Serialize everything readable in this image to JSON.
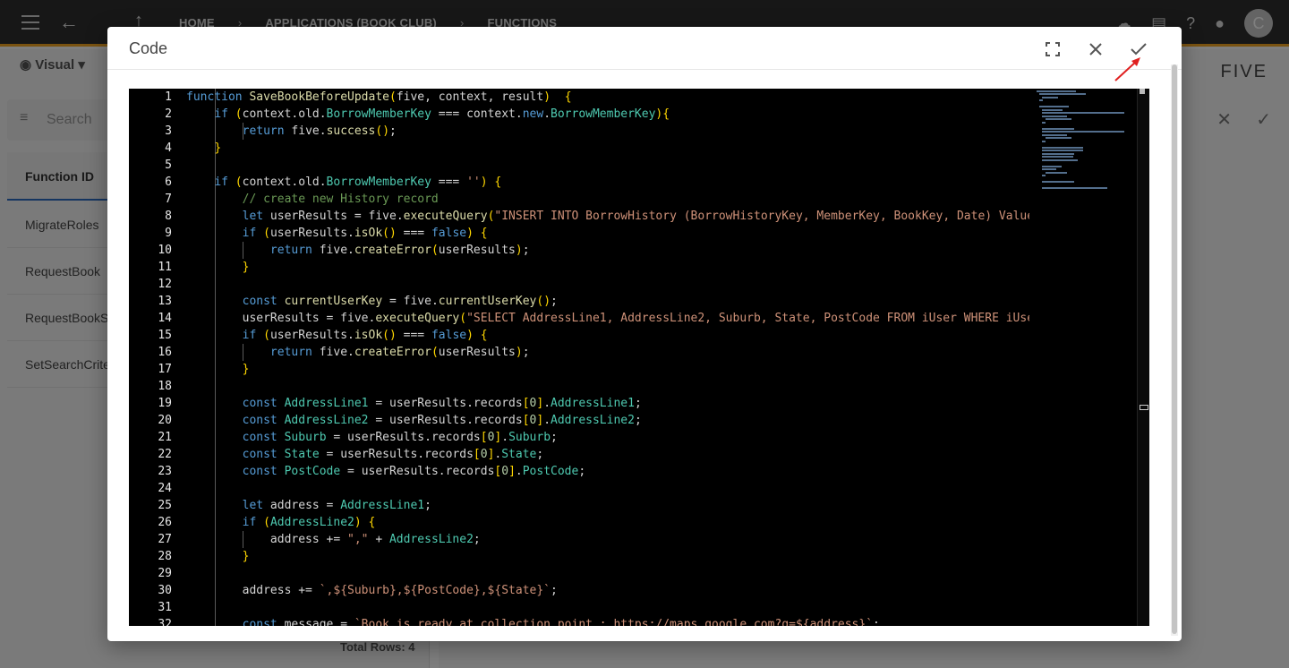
{
  "topbar": {
    "breadcrumbs": [
      "HOME",
      "APPLICATIONS (BOOK CLUB)",
      "FUNCTIONS"
    ],
    "avatar_letter": "C"
  },
  "left_panel": {
    "view_label": "Visual",
    "search_placeholder": "Search",
    "column_header": "Function ID",
    "rows": [
      "MigrateRoles",
      "RequestBook",
      "RequestBookS",
      "SetSearchCrite"
    ],
    "total_rows": "Total Rows: 4"
  },
  "brand": "FIVE",
  "dialog": {
    "title": "Code",
    "line_numbers": [
      "1",
      "2",
      "3",
      "4",
      "5",
      "6",
      "7",
      "8",
      "9",
      "10",
      "11",
      "12",
      "13",
      "14",
      "15",
      "16",
      "17",
      "18",
      "19",
      "20",
      "21",
      "22",
      "23",
      "24",
      "25",
      "26",
      "27",
      "28",
      "29",
      "30",
      "31",
      "32"
    ],
    "lines": [
      "function SaveBookBeforeUpdate(five, context, result)  {",
      "    if (context.old.BorrowMemberKey === context.new.BorrowMemberKey){",
      "        return five.success();",
      "    }",
      "",
      "    if (context.old.BorrowMemberKey === '') {",
      "        // create new History record",
      "        let userResults = five.executeQuery(\"INSERT INTO BorrowHistory (BorrowHistoryKey, MemberKey, BookKey, Date) Values(",
      "        if (userResults.isOk() === false) {",
      "            return five.createError(userResults);",
      "        }",
      "",
      "        const currentUserKey = five.currentUserKey();",
      "        userResults = five.executeQuery(\"SELECT AddressLine1, AddressLine2, Suburb, State, PostCode FROM iUser WHERE iUserK",
      "        if (userResults.isOk() === false) {",
      "            return five.createError(userResults);",
      "        }",
      "",
      "        const AddressLine1 = userResults.records[0].AddressLine1;",
      "        const AddressLine2 = userResults.records[0].AddressLine2;",
      "        const Suburb = userResults.records[0].Suburb;",
      "        const State = userResults.records[0].State;",
      "        const PostCode = userResults.records[0].PostCode;",
      "",
      "        let address = AddressLine1;",
      "        if (AddressLine2) {",
      "            address += \",\" + AddressLine2;",
      "        }",
      "",
      "        address += `,${Suburb},${PostCode},${State}`;",
      "",
      "        const message = `Book is ready at collection point : https://maps.google.com?q=${address}`;"
    ]
  }
}
